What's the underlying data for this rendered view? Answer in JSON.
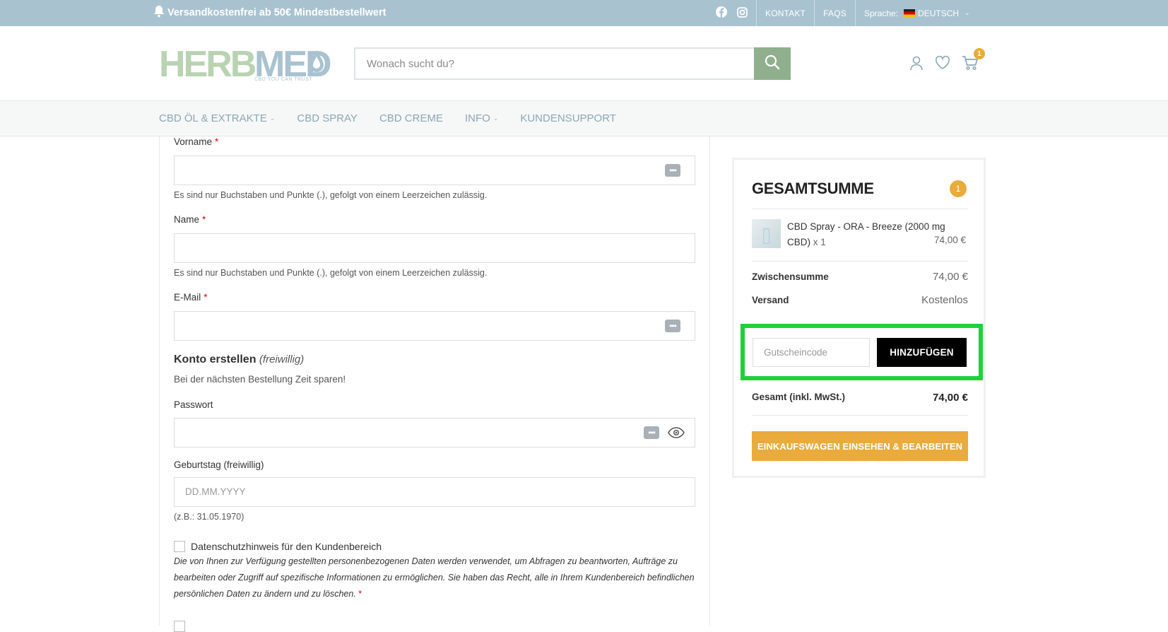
{
  "topbar": {
    "promo": "Versandkostenfrei ab 50€ Mindestbestellwert",
    "links": [
      "KONTAKT",
      "FAQS"
    ],
    "language_label": "Sprache:",
    "language_value": "DEUTSCH"
  },
  "header": {
    "logo_herb": "HERB",
    "logo_med": "MED",
    "logo_tagline": "CBD YOU CAN TRUST",
    "search_placeholder": "Wonach sucht du?",
    "cart_count": "1"
  },
  "nav": {
    "items": [
      {
        "label": "CBD ÖL & EXTRAKTE",
        "has_dropdown": true
      },
      {
        "label": "CBD SPRAY",
        "has_dropdown": false
      },
      {
        "label": "CBD CREME",
        "has_dropdown": false
      },
      {
        "label": "INFO",
        "has_dropdown": true
      },
      {
        "label": "KUNDENSUPPORT",
        "has_dropdown": false
      }
    ]
  },
  "form": {
    "firstname_label": "Vorname",
    "firstname_hint": "Es sind nur Buchstaben und Punkte (.), gefolgt von einem Leerzeichen zulässig.",
    "lastname_label": "Name",
    "lastname_hint": "Es sind nur Buchstaben und Punkte (.), gefolgt von einem Leerzeichen zulässig.",
    "email_label": "E-Mail",
    "required_mark": "*",
    "account_title": "Konto erstellen",
    "account_optional": "(freiwillig)",
    "account_subtitle": "Bei der nächsten Bestellung Zeit sparen!",
    "password_label": "Passwort",
    "birthday_label": "Geburtstag (freiwillig)",
    "birthday_placeholder": "DD.MM.YYYY",
    "birthday_hint": "(z.B.: 31.05.1970)",
    "privacy_label": "Datenschutzhinweis für den Kundenbereich",
    "privacy_text": "Die von Ihnen zur Verfügung gestellten personenbezogenen Daten werden verwendet, um Abfragen zu beantworten, Aufträge zu bearbeiten oder Zugriff auf spezifische Informationen zu ermöglichen. Sie haben das Recht, alle in Ihrem Kundenbereich befindlichen persönlichen Daten zu ändern und zu löschen."
  },
  "summary": {
    "title": "GESAMTSUMME",
    "count": "1",
    "product_name": "CBD Spray - ORA - Breeze (2000 mg CBD)",
    "product_qty": "x 1",
    "product_price": "74,00 €",
    "subtotal_label": "Zwischensumme",
    "subtotal_value": "74,00 €",
    "shipping_label": "Versand",
    "shipping_value": "Kostenlos",
    "coupon_placeholder": "Gutscheincode",
    "coupon_button": "HINZUFÜGEN",
    "total_label": "Gesamt (inkl. MwSt.)",
    "total_value": "74,00 €",
    "edit_button": "EINKAUFSWAGEN EINSEHEN & BEARBEITEN"
  },
  "colors": {
    "topbar_bg": "#a9c2cf",
    "accent_green": "#8faf8d",
    "accent_orange": "#e9ab3c",
    "highlight_green": "#1fd13b"
  }
}
